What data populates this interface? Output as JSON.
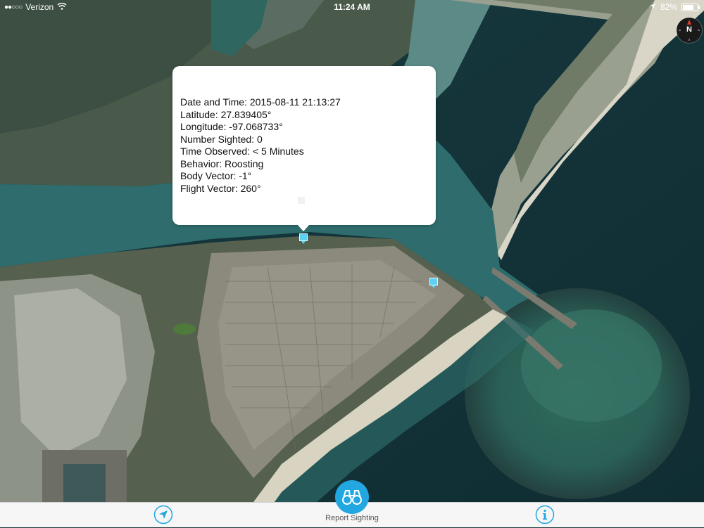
{
  "status_bar": {
    "carrier": "Verizon",
    "time": "11:24 AM",
    "battery": "82%",
    "battery_level": 0.82,
    "icons": [
      "signal-dots-icon",
      "wifi-icon",
      "location-arrow-icon",
      "battery-icon"
    ]
  },
  "map": {
    "type": "satellite",
    "compass": {
      "letter": "N",
      "icon": "compass-icon"
    },
    "pins": [
      {
        "name": "sighting-pin-selected",
        "icon": "sighting-flag-icon"
      },
      {
        "name": "sighting-pin",
        "icon": "sighting-flag-icon"
      }
    ]
  },
  "callout": {
    "lines": [
      "Date and Time:  2015-08-11 21:13:27",
      "Latitude:  27.839405°",
      "Longitude:  -97.068733°",
      "Number Sighted:  0",
      "Time Observed:  < 5 Minutes",
      "Behavior:  Roosting",
      "Body Vector:  -1°",
      "Flight Vector:  260°"
    ]
  },
  "tab_bar": {
    "locate_icon": "location-arrow-icon",
    "report": {
      "label": "Report Sighting",
      "icon": "binoculars-icon"
    },
    "info_icon": "info-icon"
  },
  "colors": {
    "accent": "#22a7e0",
    "pin": "#5fd0f2",
    "tab_bar_bg": "#f6f6f7",
    "callout_bg": "#ffffff"
  }
}
